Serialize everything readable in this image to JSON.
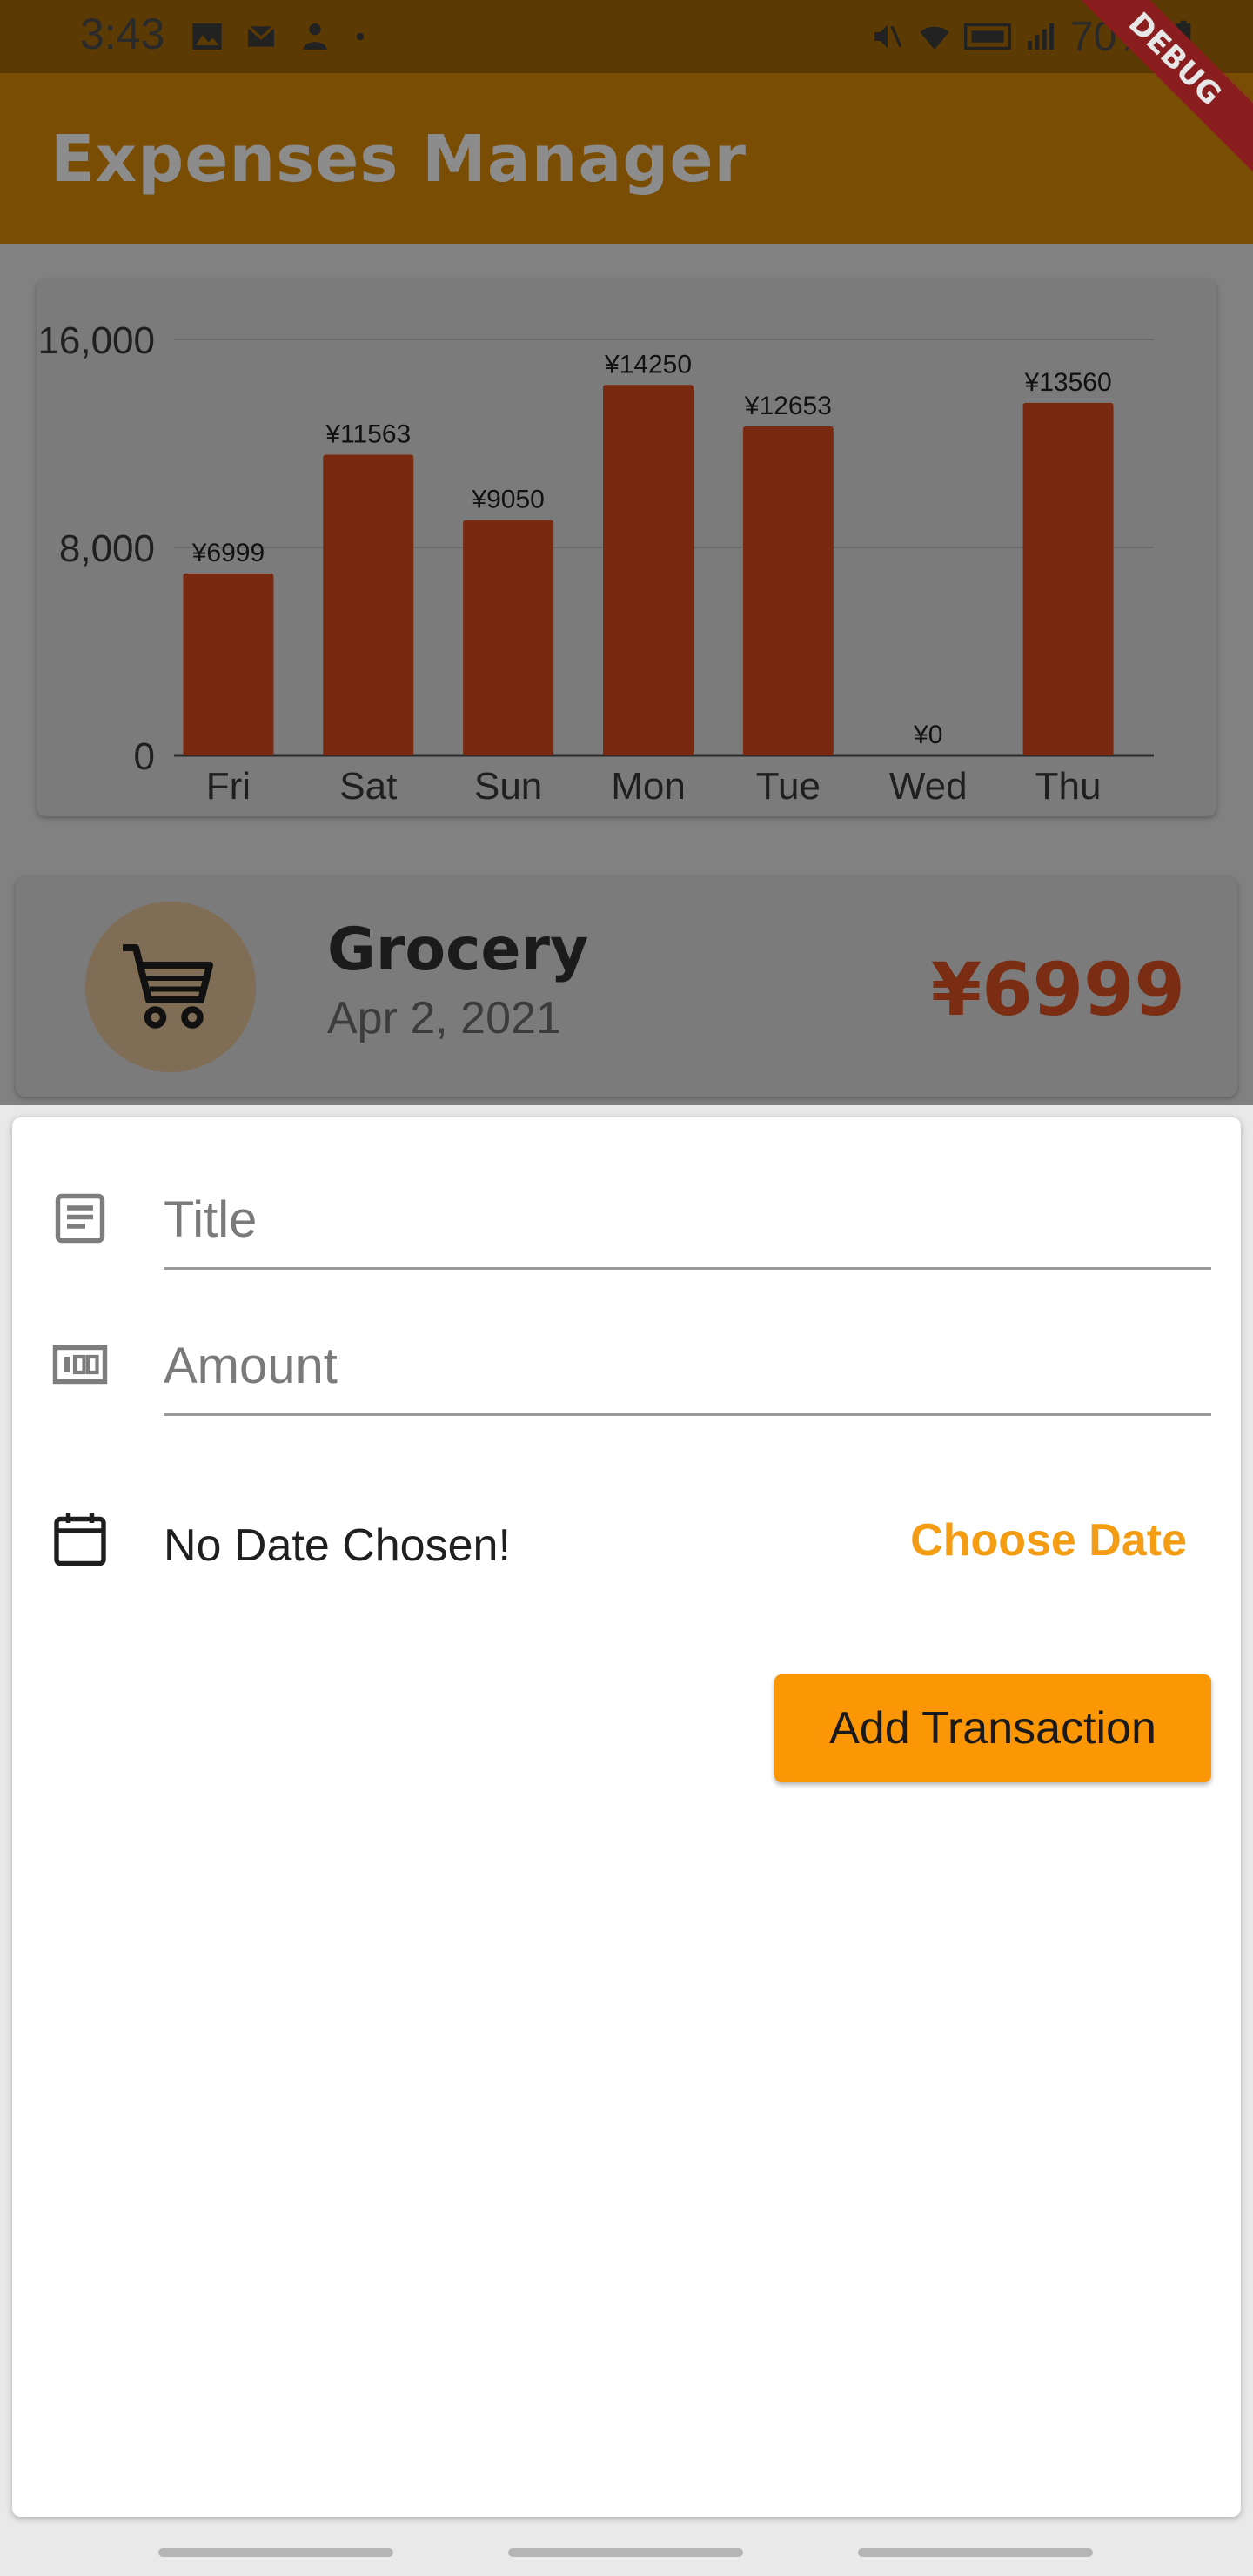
{
  "status_bar": {
    "time": "3:43",
    "battery_percent": "70%",
    "left_icons": [
      "image-icon",
      "mail-icon",
      "person-icon",
      "dot-icon"
    ],
    "right_icons": [
      "mute-icon",
      "wifi-icon",
      "volte-icon",
      "signal-icon",
      "battery-icon"
    ]
  },
  "app_bar": {
    "title": "Expenses Manager",
    "debug_label": "DEBUG"
  },
  "chart_data": {
    "type": "bar",
    "categories": [
      "Fri",
      "Sat",
      "Sun",
      "Mon",
      "Tue",
      "Wed",
      "Thu"
    ],
    "values": [
      6999,
      11563,
      9050,
      14250,
      12653,
      0,
      13560
    ],
    "value_labels": [
      "¥6999",
      "¥11563",
      "¥9050",
      "¥14250",
      "¥12653",
      "¥0",
      "¥13560"
    ],
    "y_ticks": [
      "0",
      "8,000",
      "16,000"
    ],
    "ylim": [
      0,
      16000
    ],
    "grid": true,
    "bar_color": "#7a2911"
  },
  "transaction": {
    "title": "Grocery",
    "date": "Apr 2, 2021",
    "amount": "¥6999",
    "icon": "cart-icon"
  },
  "form": {
    "title_placeholder": "Title",
    "amount_placeholder": "Amount",
    "no_date_text": "No Date Chosen!",
    "choose_date_label": "Choose Date",
    "add_button_label": "Add Transaction"
  },
  "colors": {
    "accent": "#fb9605",
    "choose_date": "#f39c14",
    "app_bar": "#7a4d05"
  }
}
